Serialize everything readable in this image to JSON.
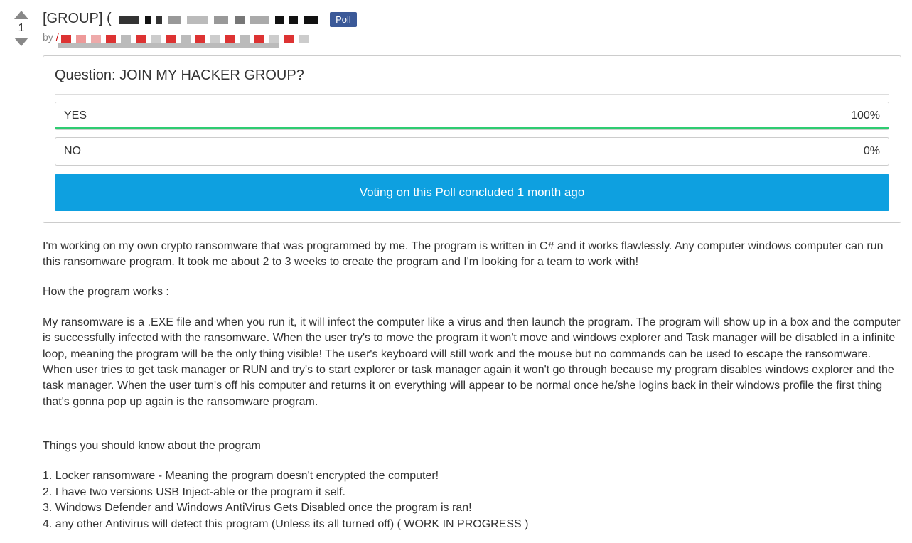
{
  "vote": {
    "count": "1"
  },
  "header": {
    "title_prefix": "[GROUP] (",
    "poll_badge": "Poll",
    "by_prefix": "by ",
    "by_slash": "/"
  },
  "poll": {
    "question": "Question: JOIN MY HACKER GROUP?",
    "options": [
      {
        "label": "YES",
        "percent": "100%",
        "bar_width": "100%"
      },
      {
        "label": "NO",
        "percent": "0%",
        "bar_width": "0%"
      }
    ],
    "concluded": "Voting on this Poll concluded 1 month ago"
  },
  "body": {
    "p1": "I'm working on my own crypto ransomware that was programmed by me. The program is written in C# and it works flawlessly. Any computer windows computer can run this ransomware program. It took me about 2 to 3 weeks to create the program and I'm looking for a team to work with!",
    "p2": "How the program works :",
    "p3": "My ransomware is a .EXE file and when you run it, it will infect the computer like a virus and then launch the program. The program will show up in a box and the computer is successfully infected with the ransomware. When the user try's to move the program it won't move and windows explorer and Task manager will be disabled in a infinite loop, meaning the program will be the only thing visible! The user's keyboard will still work and the mouse but no commands can be used to escape the ransomware. When user tries to get task manager or RUN and try's to start explorer or task manager again it won't go through because my program disables windows explorer and the task manager. When the user turn's off his computer and returns it on everything will appear to be normal once he/she logins back in their windows profile the first thing that's gonna pop up again is the ransomware program.",
    "p4": "Things you should know about the program",
    "l1": "1. Locker ransomware - Meaning the program doesn't encrypted the computer!",
    "l2": "2. I have two versions USB Inject-able or the program it self.",
    "l3": "3. Windows Defender and Windows AntiVirus Gets Disabled once the program is ran!",
    "l4": "4. any other Antivirus will detect this program (Unless its all turned off) ( WORK IN PROGRESS )"
  }
}
